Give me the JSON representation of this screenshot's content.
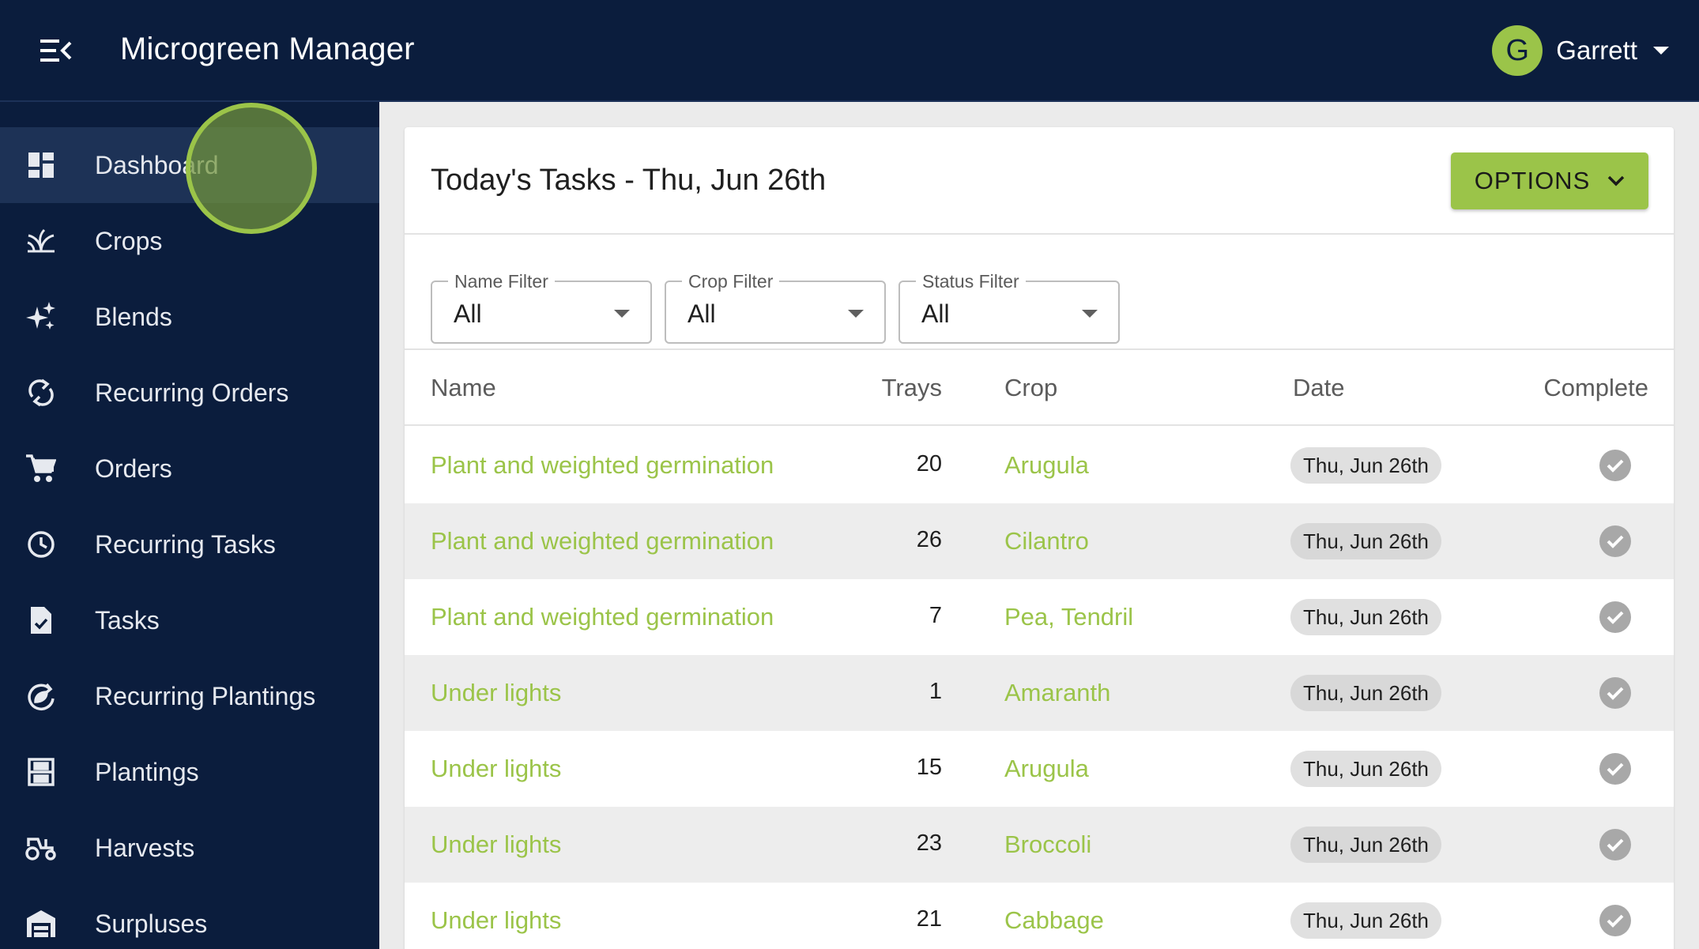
{
  "app": {
    "title": "Microgreen Manager"
  },
  "user": {
    "initial": "G",
    "name": "Garrett"
  },
  "sidebar": {
    "items": [
      {
        "label": "Dashboard",
        "icon": "dashboard-icon",
        "active": true
      },
      {
        "label": "Crops",
        "icon": "sprout-icon"
      },
      {
        "label": "Blends",
        "icon": "sparkle-icon"
      },
      {
        "label": "Recurring Orders",
        "icon": "refresh-icon"
      },
      {
        "label": "Orders",
        "icon": "cart-icon"
      },
      {
        "label": "Recurring Tasks",
        "icon": "clock-icon"
      },
      {
        "label": "Tasks",
        "icon": "task-file-icon"
      },
      {
        "label": "Recurring Plantings",
        "icon": "recurring-planting-icon"
      },
      {
        "label": "Plantings",
        "icon": "shelf-icon"
      },
      {
        "label": "Harvests",
        "icon": "tractor-icon"
      },
      {
        "label": "Surpluses",
        "icon": "warehouse-icon"
      }
    ]
  },
  "card": {
    "title": "Today's Tasks - Thu, Jun 26th",
    "options_label": "OPTIONS"
  },
  "filters": [
    {
      "label": "Name Filter",
      "value": "All"
    },
    {
      "label": "Crop Filter",
      "value": "All"
    },
    {
      "label": "Status Filter",
      "value": "All"
    }
  ],
  "table": {
    "headers": {
      "name": "Name",
      "trays": "Trays",
      "crop": "Crop",
      "date": "Date",
      "complete": "Complete"
    },
    "rows": [
      {
        "name": "Plant and weighted germination",
        "trays": "20",
        "crop": "Arugula",
        "date": "Thu, Jun 26th"
      },
      {
        "name": "Plant and weighted germination",
        "trays": "26",
        "crop": "Cilantro",
        "date": "Thu, Jun 26th"
      },
      {
        "name": "Plant and weighted germination",
        "trays": "7",
        "crop": "Pea, Tendril",
        "date": "Thu, Jun 26th"
      },
      {
        "name": "Under lights",
        "trays": "1",
        "crop": "Amaranth",
        "date": "Thu, Jun 26th"
      },
      {
        "name": "Under lights",
        "trays": "15",
        "crop": "Arugula",
        "date": "Thu, Jun 26th"
      },
      {
        "name": "Under lights",
        "trays": "23",
        "crop": "Broccoli",
        "date": "Thu, Jun 26th"
      },
      {
        "name": "Under lights",
        "trays": "21",
        "crop": "Cabbage",
        "date": "Thu, Jun 26th"
      }
    ]
  },
  "colors": {
    "navy": "#0b1d3d",
    "accent_green": "#9bc449",
    "active_nav": "#1d3256"
  }
}
